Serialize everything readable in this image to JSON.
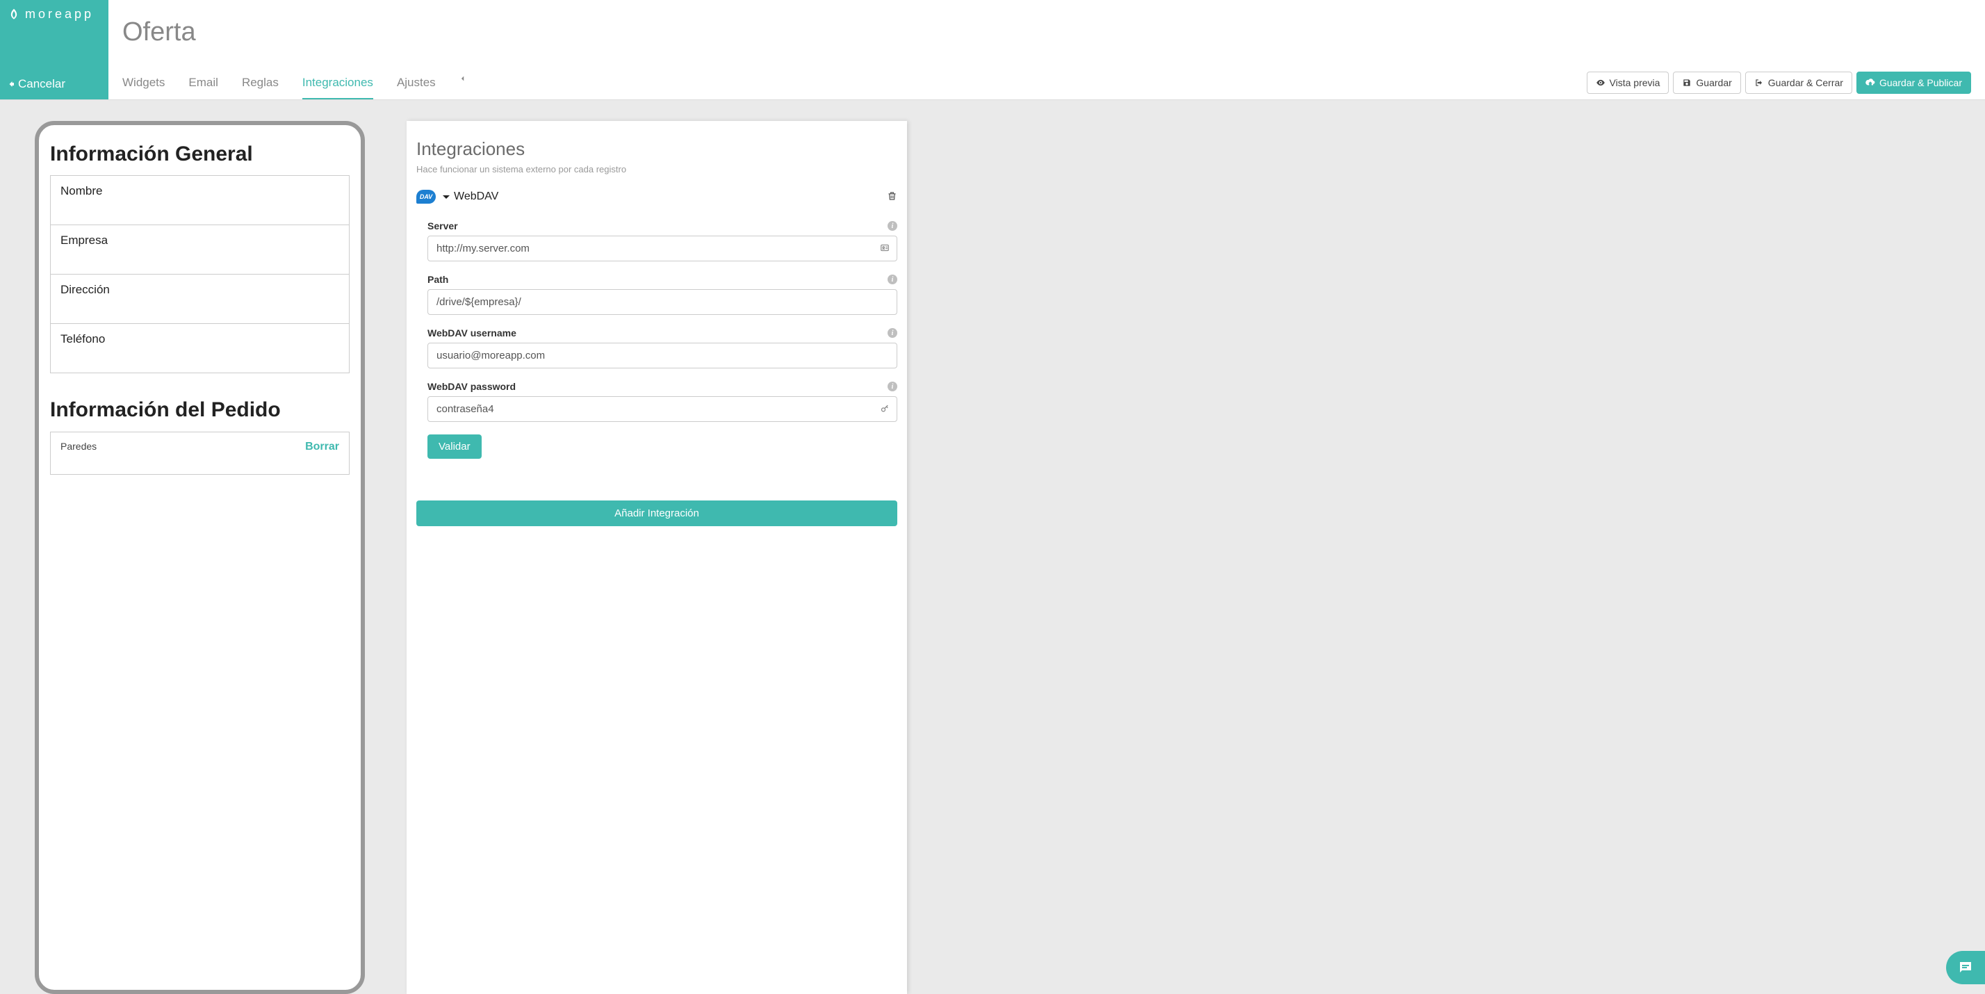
{
  "brand": {
    "name": "moreapp",
    "cancel_label": "Cancelar"
  },
  "page": {
    "title": "Oferta"
  },
  "tabs": {
    "widgets": "Widgets",
    "email": "Email",
    "reglas": "Reglas",
    "integraciones": "Integraciones",
    "ajustes": "Ajustes"
  },
  "actions": {
    "preview": "Vista previa",
    "save": "Guardar",
    "save_close": "Guardar & Cerrar",
    "save_publish": "Guardar & Publicar"
  },
  "preview": {
    "section1_title": "Información General",
    "fields": {
      "nombre": "Nombre",
      "empresa": "Empresa",
      "direccion": "Dirección",
      "telefono": "Teléfono"
    },
    "section2_title": "Información del Pedido",
    "pedido_field": "Paredes",
    "borrar_label": "Borrar"
  },
  "panel": {
    "title": "Integraciones",
    "subtitle": "Hace funcionar un sistema externo por cada registro",
    "integration_name": "WebDAV",
    "dav_label": "DAV",
    "fields": {
      "server": {
        "label": "Server",
        "value": "http://my.server.com"
      },
      "path": {
        "label": "Path",
        "value": "/drive/${empresa}/"
      },
      "username": {
        "label": "WebDAV username",
        "value": "usuario@moreapp.com"
      },
      "password": {
        "label": "WebDAV password",
        "value": "contraseña4"
      }
    },
    "validate_label": "Validar",
    "add_label": "Añadir Integración"
  }
}
